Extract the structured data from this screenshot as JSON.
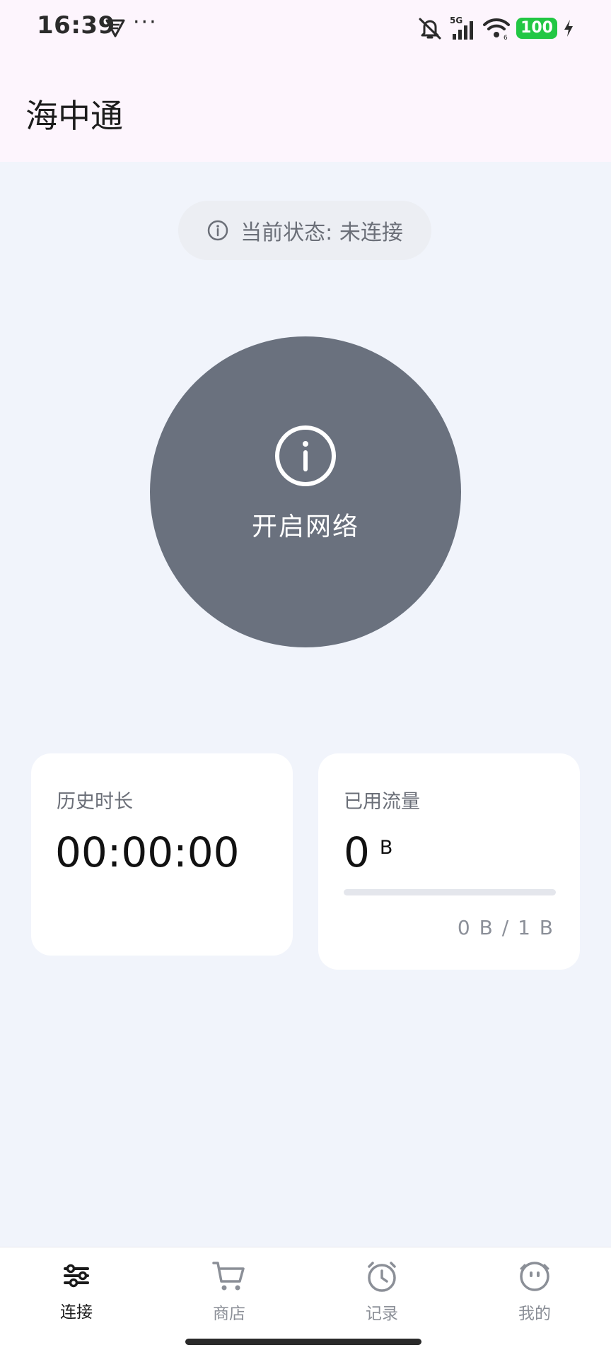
{
  "status_bar": {
    "time": "16:39",
    "dots": "···",
    "network": "5G",
    "battery": "100"
  },
  "header": {
    "title": "海中通"
  },
  "status": {
    "text": "当前状态: 未连接"
  },
  "connect_button": {
    "label": "开启网络"
  },
  "history_card": {
    "title": "历史时长",
    "value": "00:00:00"
  },
  "traffic_card": {
    "title": "已用流量",
    "value": "0",
    "unit": "B",
    "usage": "0 B / 1 B",
    "progress": 0
  },
  "nav": {
    "items": [
      {
        "label": "连接",
        "active": true
      },
      {
        "label": "商店",
        "active": false
      },
      {
        "label": "记录",
        "active": false
      },
      {
        "label": "我的",
        "active": false
      }
    ]
  },
  "colors": {
    "page_bg": "#f1f4fb",
    "header_bg": "#fdf5fd",
    "button_bg": "#6a717e",
    "battery": "#22c744",
    "nav_inactive": "#8b8f97"
  },
  "icons": {
    "status": [
      "vpn-icon",
      "mute-icon",
      "signal-icon",
      "wifi-icon",
      "charging-icon"
    ],
    "pill": "info-icon",
    "button": "info-icon",
    "nav": [
      "connect-icon",
      "cart-icon",
      "clock-icon",
      "face-icon"
    ]
  }
}
